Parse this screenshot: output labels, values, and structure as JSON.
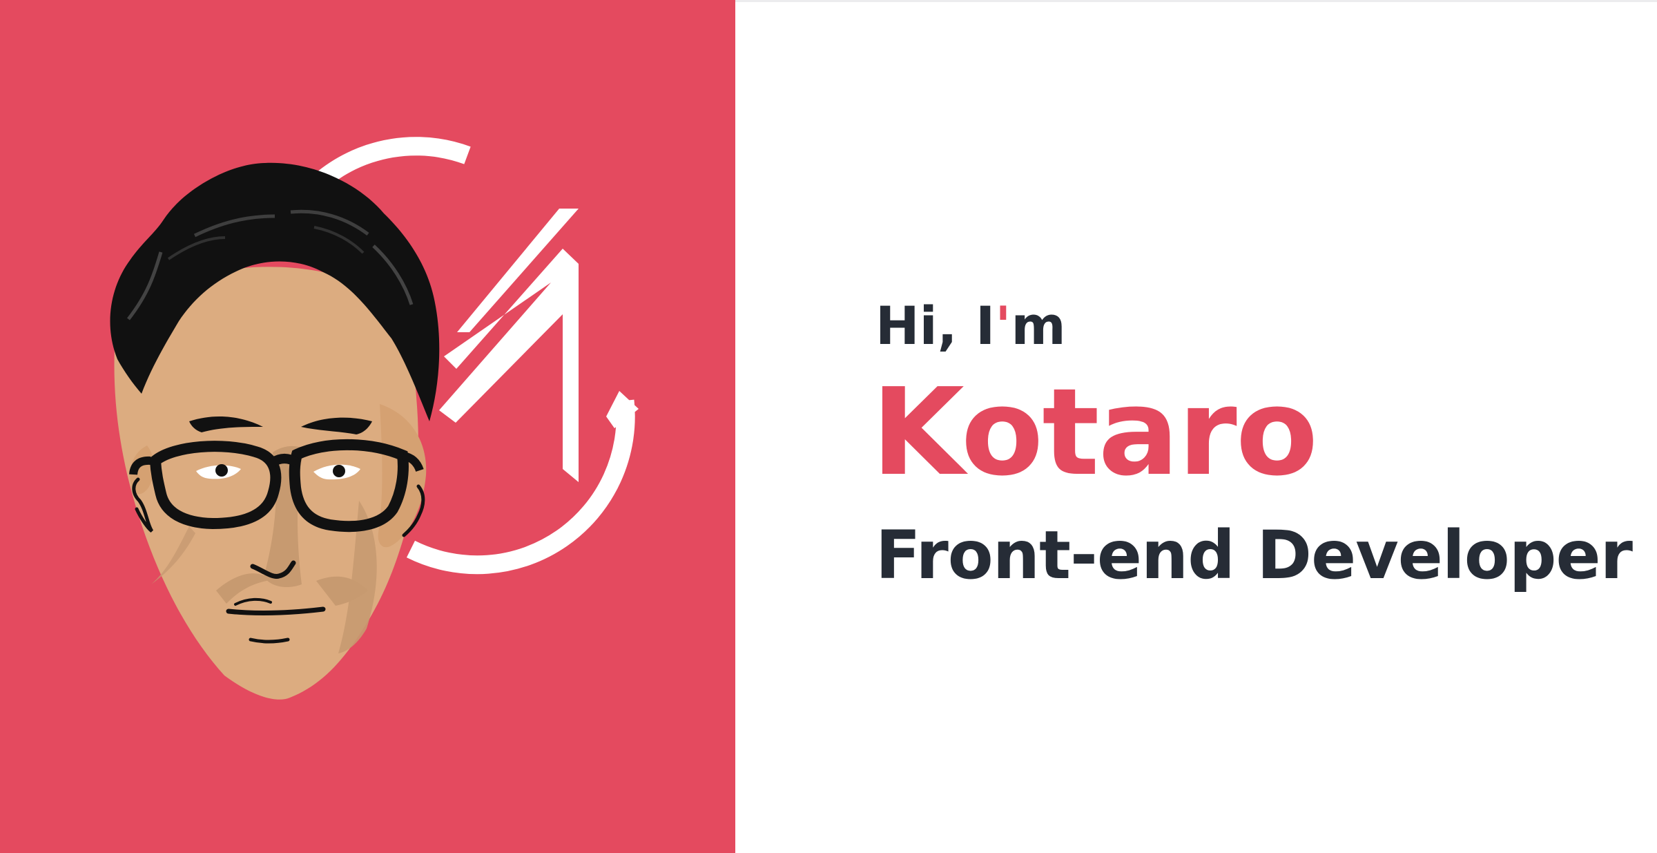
{
  "hero": {
    "greeting_before": "Hi, I",
    "greeting_apostrophe": "'",
    "greeting_after": "m",
    "name": "Kotaro",
    "role": "Front-end Developer"
  },
  "colors": {
    "accent": "#e44a5f",
    "text": "#262c36",
    "background": "#ffffff"
  }
}
